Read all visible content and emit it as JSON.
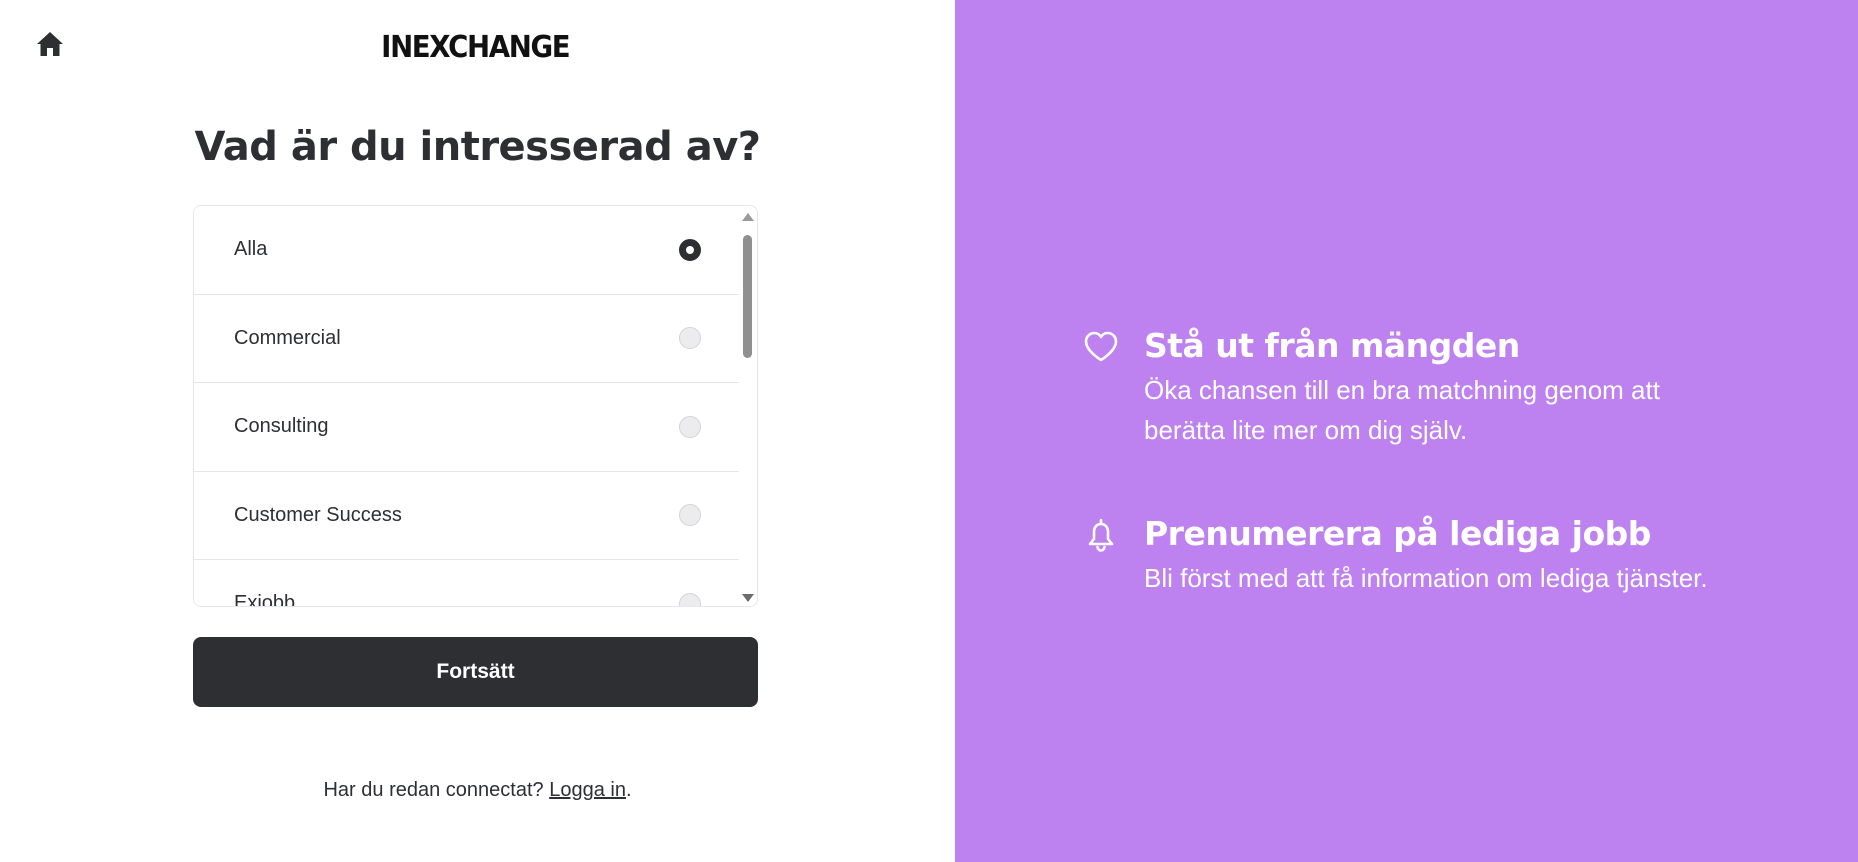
{
  "brand": {
    "logo_text": "INEXCHANGE",
    "accent_color": "#bd81f0",
    "dark_color": "#2d2f33"
  },
  "icons": {
    "home": "home-icon",
    "heart": "heart-icon",
    "bell": "bell-icon"
  },
  "main": {
    "title": "Vad är du intresserad av?",
    "options": [
      {
        "label": "Alla",
        "selected": true
      },
      {
        "label": "Commercial",
        "selected": false
      },
      {
        "label": "Consulting",
        "selected": false
      },
      {
        "label": "Customer Success",
        "selected": false
      },
      {
        "label": "Exjobb",
        "selected": false
      }
    ],
    "continue_label": "Fortsätt",
    "login_prompt": "Har du redan connectat?",
    "login_link": "Logga in",
    "login_suffix": "."
  },
  "features": [
    {
      "title": "Stå ut från mängden",
      "description": "Öka chansen till en bra matchning genom att berätta lite mer om dig själv."
    },
    {
      "title": "Prenumerera på lediga jobb",
      "description": "Bli först med att få information om lediga tjänster."
    }
  ]
}
